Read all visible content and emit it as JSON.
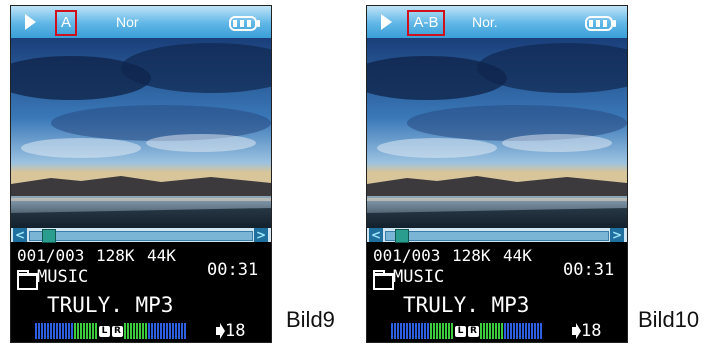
{
  "players": [
    {
      "mode_label": "A",
      "eq_label": "Nor",
      "track_counter": "001/003",
      "bitrate": "128K",
      "samplerate": "44K",
      "time": "00:31",
      "folder": "MUSIC",
      "filename": "TRULY. MP3",
      "lr_left": "L",
      "lr_right": "R",
      "volume": "18",
      "seek_left_arrow": "<",
      "seek_right_arrow": ">",
      "caption": "Bild9"
    },
    {
      "mode_label": "A-B",
      "eq_label": "Nor.",
      "track_counter": "001/003",
      "bitrate": "128K",
      "samplerate": "44K",
      "time": "00:31",
      "folder": "MUSIC",
      "filename": "TRULY. MP3",
      "lr_left": "L",
      "lr_right": "R",
      "volume": "18",
      "seek_left_arrow": "<",
      "seek_right_arrow": ">",
      "caption": "Bild10"
    }
  ],
  "colors": {
    "header_gradient_top": "#bfe3f7",
    "header_gradient_bottom": "#3a9fd8",
    "highlight_box": "#d0101a",
    "meter_blue": "#2d5fe0",
    "meter_green": "#3dcc3d"
  },
  "icons": [
    "play-icon",
    "battery-icon",
    "folder-icon",
    "lr-icon",
    "volume-icon",
    "seek-arrow-icon"
  ]
}
